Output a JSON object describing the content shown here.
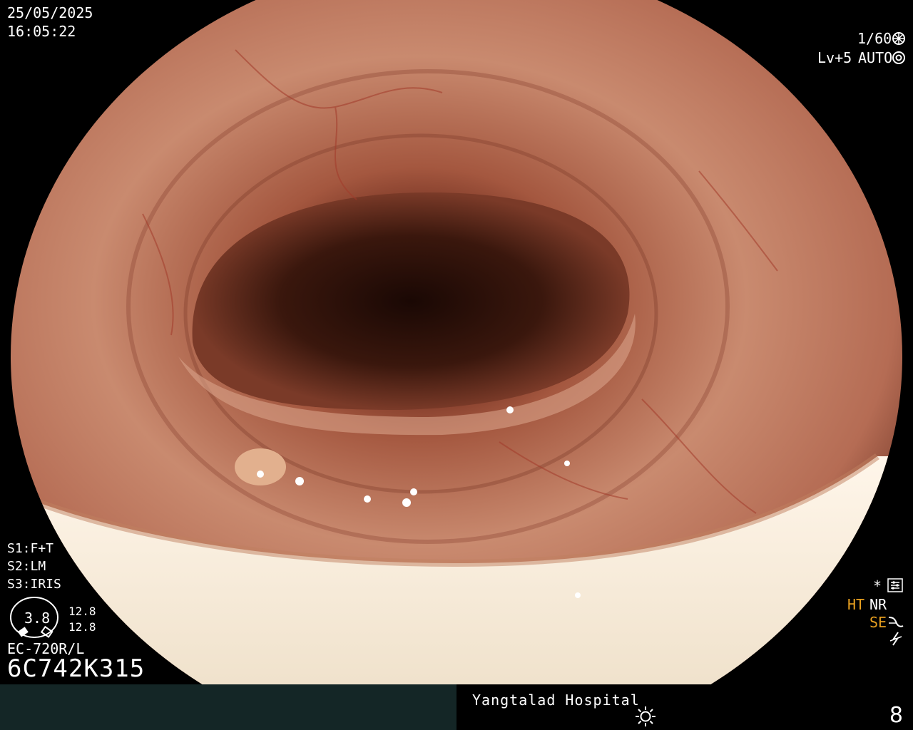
{
  "header": {
    "date": "25/05/2025",
    "time": "16:05:22"
  },
  "camera": {
    "shutter": "1/60",
    "level": "Lv+5",
    "mode": "AUTO"
  },
  "settings": {
    "s1": "S1:F+T",
    "s2": "S2:LM",
    "s3": "S3:IRIS"
  },
  "gauge": {
    "value": "3.8",
    "top": "12.8",
    "bottom": "12.8"
  },
  "scope_info": {
    "model": "EC-720R/L",
    "serial": "6C742K315"
  },
  "right_panel": {
    "asterisk": "*",
    "ht": "HT",
    "nr": "NR",
    "se": "SE"
  },
  "footer": {
    "hospital": "Yangtalad Hospital",
    "page": "8"
  },
  "colors": {
    "accent": "#e8a020",
    "footer_left": "#142626"
  },
  "icons": [
    "shutter-icon",
    "auto-iris-icon",
    "settings-icon",
    "curve-icon",
    "flash-off-icon",
    "brightness-icon",
    "scope-gauge-icon"
  ]
}
